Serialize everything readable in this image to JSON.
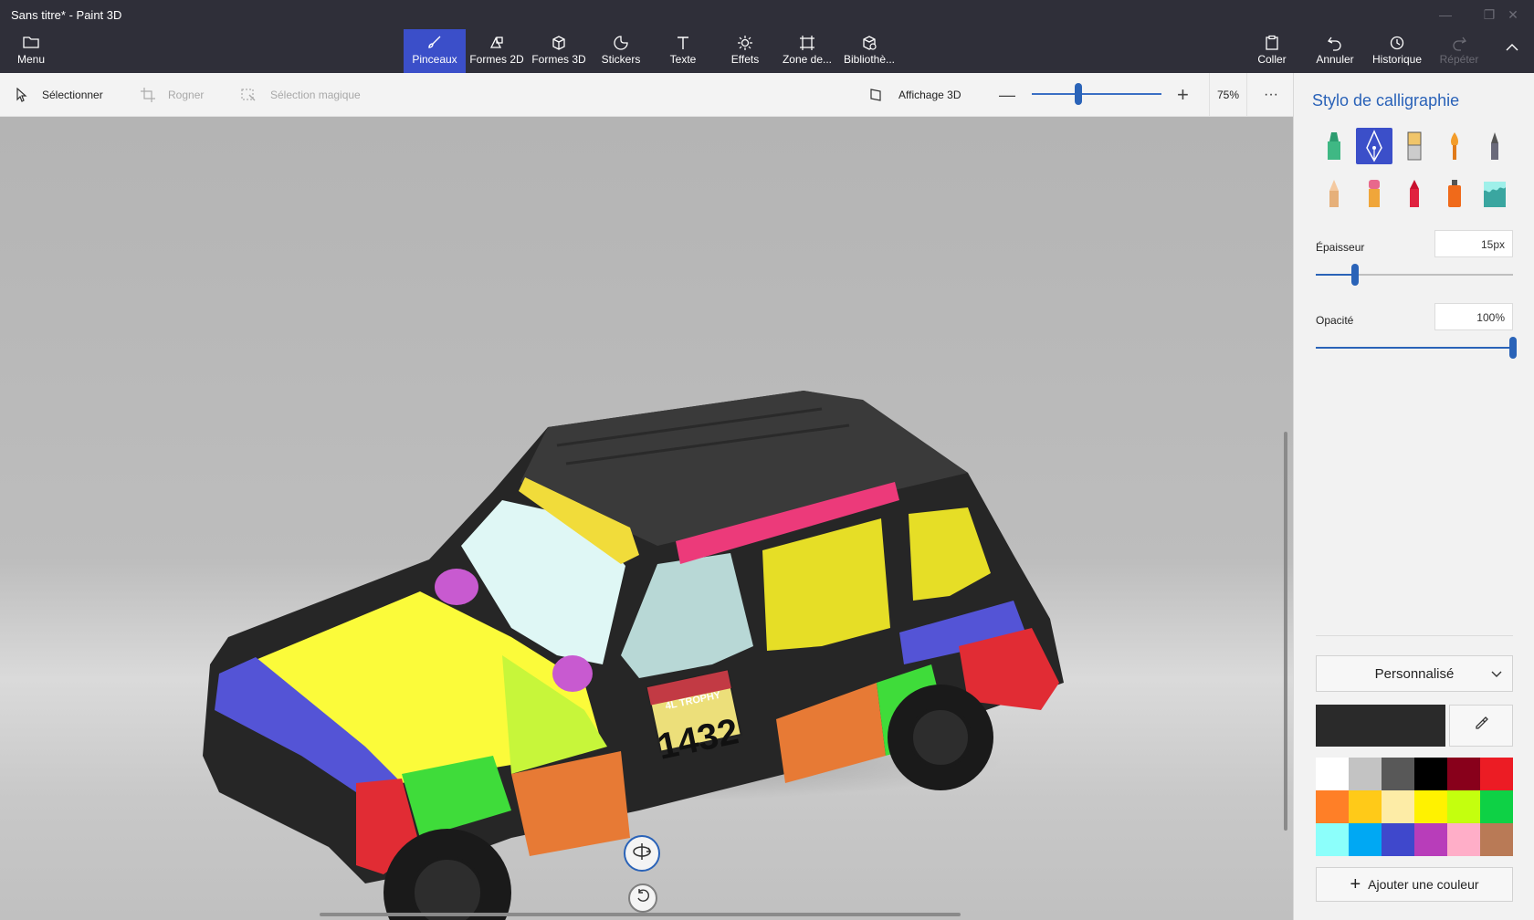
{
  "window": {
    "title": "Sans titre* - Paint 3D"
  },
  "ribbon": {
    "menu": "Menu",
    "tools": [
      {
        "label": "Pinceaux",
        "icon": "brush-icon"
      },
      {
        "label": "Formes 2D",
        "icon": "shapes-2d-icon"
      },
      {
        "label": "Formes 3D",
        "icon": "cube-icon"
      },
      {
        "label": "Stickers",
        "icon": "sticker-icon"
      },
      {
        "label": "Texte",
        "icon": "text-icon"
      },
      {
        "label": "Effets",
        "icon": "sun-icon"
      },
      {
        "label": "Zone de...",
        "icon": "crop-canvas-icon"
      },
      {
        "label": "Bibliothè...",
        "icon": "library-icon"
      }
    ],
    "right": [
      {
        "label": "Coller",
        "icon": "paste-icon"
      },
      {
        "label": "Annuler",
        "icon": "undo-icon"
      },
      {
        "label": "Historique",
        "icon": "history-icon"
      },
      {
        "label": "Répéter",
        "icon": "redo-icon"
      }
    ]
  },
  "toolbar": {
    "select": "Sélectionner",
    "crop": "Rogner",
    "magic": "Sélection magique",
    "view3d": "Affichage 3D",
    "zoom": "75%",
    "zoom_level": 0.36,
    "more": "···"
  },
  "car": {
    "plate": "1432",
    "sticker": "4L TROPHY"
  },
  "panel": {
    "title": "Stylo de calligraphie",
    "thickness_label": "Épaisseur",
    "thickness_value": "15px",
    "thickness_level": 0.2,
    "opacity_label": "Opacité",
    "opacity_value": "100%",
    "opacity_level": 1.0,
    "preset": "Personnalisé",
    "add_color": "Ajouter une couleur",
    "current_color": "#2a2a2a",
    "palette": [
      "#ffffff",
      "#c3c3c3",
      "#585858",
      "#000000",
      "#88001b",
      "#ec1c24",
      "#ff7f27",
      "#ffca18",
      "#fdeca6",
      "#fff200",
      "#c4ff0e",
      "#0ed145",
      "#8cfffb",
      "#00a8f3",
      "#3f48cc",
      "#b83dba",
      "#ffaec8",
      "#b97a56"
    ]
  }
}
